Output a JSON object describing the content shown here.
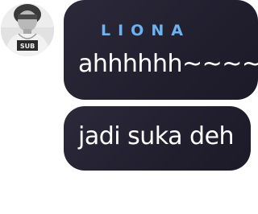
{
  "avatar": {
    "shirt_text": "SUB"
  },
  "messages": [
    {
      "sender": "LIONA",
      "text": "ahhhhhh~~~~"
    },
    {
      "text": "jadi suka deh"
    }
  ],
  "colors": {
    "bubble_background": "#25232f",
    "sender_name": "#6db3f2",
    "message_text": "#ffffff"
  }
}
